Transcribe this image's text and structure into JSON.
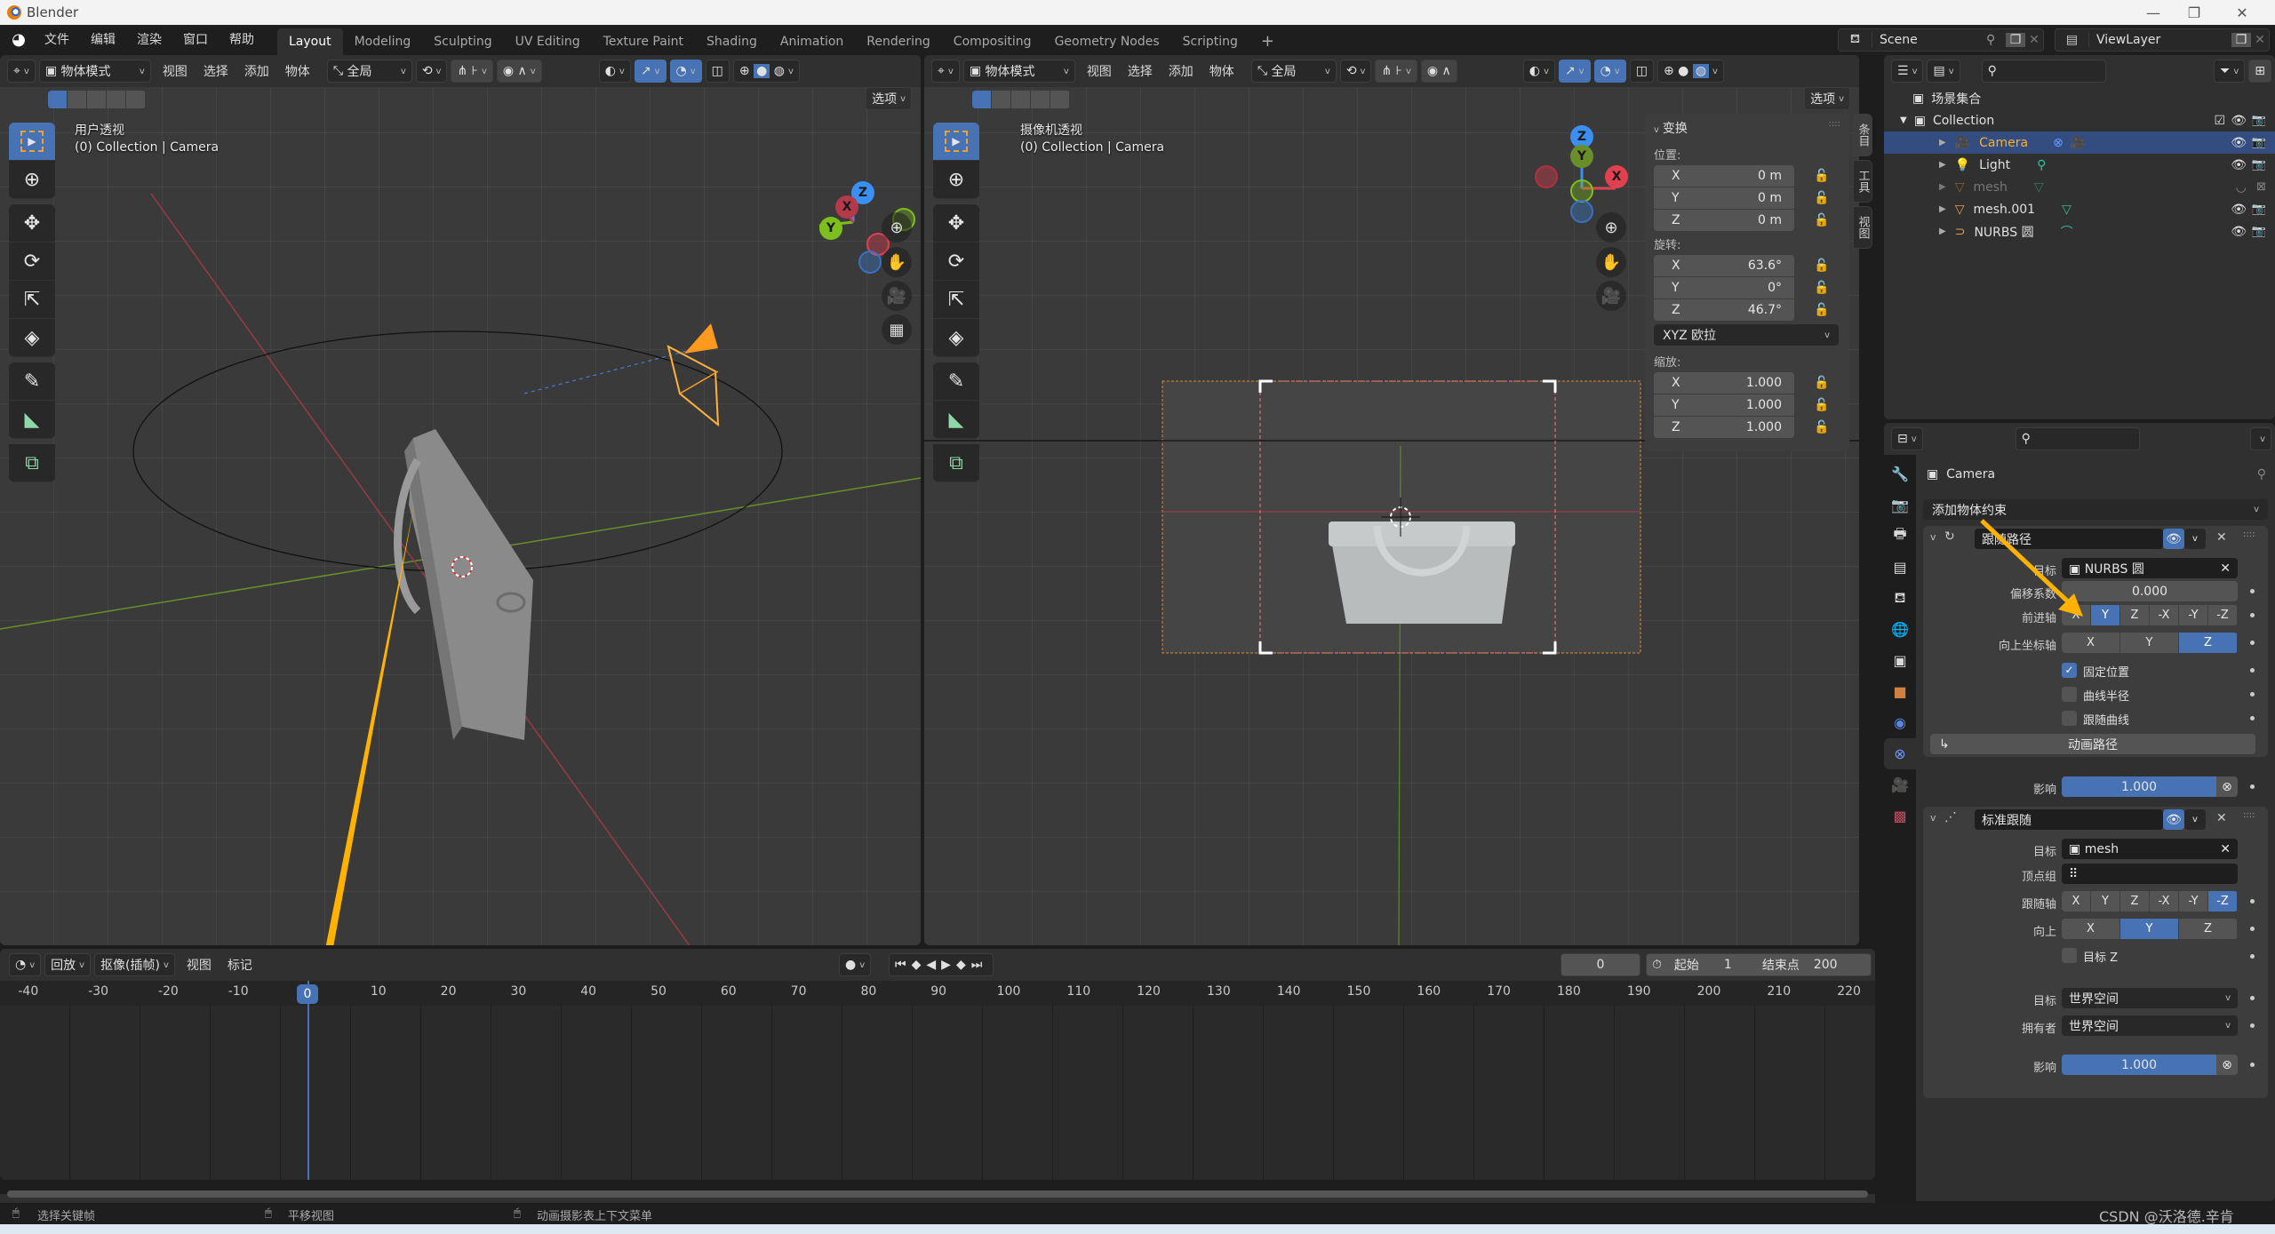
{
  "window": {
    "title": "Blender",
    "controls": [
      "minimize",
      "maximize",
      "close"
    ]
  },
  "topbar": {
    "menus": [
      "文件",
      "编辑",
      "渲染",
      "窗口",
      "帮助"
    ],
    "workspaces": [
      {
        "label": "Layout",
        "active": true
      },
      {
        "label": "Modeling"
      },
      {
        "label": "Sculpting"
      },
      {
        "label": "UV Editing"
      },
      {
        "label": "Texture Paint"
      },
      {
        "label": "Shading"
      },
      {
        "label": "Animation"
      },
      {
        "label": "Rendering"
      },
      {
        "label": "Compositing"
      },
      {
        "label": "Geometry Nodes"
      },
      {
        "label": "Scripting"
      }
    ],
    "add_workspace": "+",
    "scene": "Scene",
    "view_layer": "ViewLayer"
  },
  "viewport_left": {
    "mode": "物体模式",
    "menus": [
      "视图",
      "选择",
      "添加",
      "物体"
    ],
    "orientation": "全局",
    "options": "选项",
    "view_name": "用户透视",
    "context": "(0) Collection | Camera",
    "gizmo": {
      "x": "X",
      "y": "Y",
      "z": "Z"
    }
  },
  "viewport_right": {
    "mode": "物体模式",
    "menus": [
      "视图",
      "选择",
      "添加",
      "物体"
    ],
    "orientation": "全局",
    "options": "选项",
    "view_name": "摄像机透视",
    "context": "(0) Collection | Camera",
    "gizmo": {
      "x": "X",
      "y": "Y",
      "z": "Z"
    }
  },
  "npanel": {
    "header": "变换",
    "location_label": "位置:",
    "location": [
      {
        "axis": "X",
        "value": "0 m"
      },
      {
        "axis": "Y",
        "value": "0 m"
      },
      {
        "axis": "Z",
        "value": "0 m"
      }
    ],
    "rotation_label": "旋转:",
    "rotation": [
      {
        "axis": "X",
        "value": "63.6°"
      },
      {
        "axis": "Y",
        "value": "0°"
      },
      {
        "axis": "Z",
        "value": "46.7°"
      }
    ],
    "rotation_mode": "XYZ 欧拉",
    "scale_label": "缩放:",
    "scale": [
      {
        "axis": "X",
        "value": "1.000"
      },
      {
        "axis": "Y",
        "value": "1.000"
      },
      {
        "axis": "Z",
        "value": "1.000"
      }
    ],
    "tabs": [
      "条目",
      "工具",
      "视图"
    ]
  },
  "outliner": {
    "root": "场景集合",
    "collection": "Collection",
    "items": [
      {
        "name": "Camera",
        "selected": true
      },
      {
        "name": "Light"
      },
      {
        "name": "mesh",
        "hidden": true
      },
      {
        "name": "mesh.001"
      },
      {
        "name": "NURBS 圆"
      }
    ]
  },
  "properties": {
    "object_name": "Camera",
    "add_constraint": "添加物体约束",
    "follow_path": {
      "name": "跟随路径",
      "target_label": "目标",
      "target": "NURBS 圆",
      "offset_label": "偏移系数",
      "offset": "0.000",
      "forward_label": "前进轴",
      "forward_axes": [
        "X",
        "Y",
        "Z",
        "-X",
        "-Y",
        "-Z"
      ],
      "forward_selected": "Y",
      "up_label": "向上坐标轴",
      "up_axes": [
        "X",
        "Y",
        "Z"
      ],
      "up_selected": "Z",
      "fixed_position": "固定位置",
      "fixed_position_checked": true,
      "curve_radius": "曲线半径",
      "curve_radius_checked": false,
      "follow_curve": "跟随曲线",
      "follow_curve_checked": false,
      "animate_path": "动画路径",
      "influence_label": "影响",
      "influence": "1.000"
    },
    "track_to": {
      "name": "标准跟随",
      "target_label": "目标",
      "target": "mesh",
      "vertex_group_label": "顶点组",
      "track_axis_label": "跟随轴",
      "track_axes": [
        "X",
        "Y",
        "Z",
        "-X",
        "-Y",
        "-Z"
      ],
      "track_selected": "-Z",
      "up_label": "向上",
      "up_axes": [
        "X",
        "Y",
        "Z"
      ],
      "up_selected": "Y",
      "target_z": "目标 Z",
      "target_z_checked": false,
      "target_space_label": "目标",
      "target_space": "世界空间",
      "owner_space_label": "拥有者",
      "owner_space": "世界空间",
      "influence_label": "影响",
      "influence": "1.000"
    }
  },
  "timeline": {
    "menus": [
      "回放",
      "抠像(插帧)",
      "视图",
      "标记"
    ],
    "current_frame": "0",
    "start_label": "起始",
    "start": "1",
    "end_label": "结束点",
    "end": "200",
    "ruler": [
      "-40",
      "-30",
      "-20",
      "-10",
      "0",
      "10",
      "20",
      "30",
      "40",
      "50",
      "60",
      "70",
      "80",
      "90",
      "100",
      "110",
      "120",
      "130",
      "140",
      "150",
      "160",
      "170",
      "180",
      "190",
      "200",
      "210",
      "220"
    ]
  },
  "statusbar": {
    "left": "选择关键帧",
    "middle": "平移视图",
    "right": "动画摄影表上下文菜单",
    "watermark": "CSDN @沃洛德.辛肯"
  },
  "colors": {
    "accent": "#4772b3",
    "selected_object": "#ffaf29",
    "annotation_arrow": "#ffb300"
  }
}
